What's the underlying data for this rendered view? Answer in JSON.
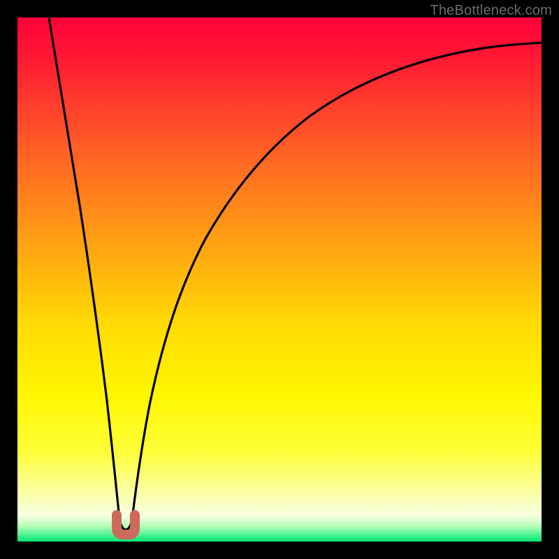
{
  "watermark": "TheBottleneck.com",
  "colors": {
    "frame": "#000000",
    "curve": "#000000",
    "marker": "#cc6b5a",
    "gradient_top": "#ff003a",
    "gradient_bottom": "#00e676"
  },
  "chart_data": {
    "type": "line",
    "title": "",
    "xlabel": "",
    "ylabel": "",
    "xlim": [
      0,
      100
    ],
    "ylim": [
      0,
      100
    ],
    "series": [
      {
        "name": "bottleneck-curve",
        "x": [
          6,
          8,
          10,
          12,
          14,
          16,
          17,
          18,
          19,
          20,
          21,
          22,
          24,
          26,
          28,
          30,
          34,
          38,
          44,
          50,
          58,
          66,
          74,
          82,
          90,
          100
        ],
        "values": [
          100,
          88,
          76,
          63,
          50,
          35,
          25,
          13,
          3,
          0,
          3,
          12,
          26,
          36,
          44,
          51,
          61,
          68,
          75,
          80,
          84,
          87,
          89.5,
          91.5,
          93,
          94.5
        ]
      }
    ],
    "annotations": [
      {
        "name": "min-marker",
        "x": 20,
        "y": 1.5,
        "shape": "u",
        "color": "#cc6b5a"
      }
    ]
  }
}
